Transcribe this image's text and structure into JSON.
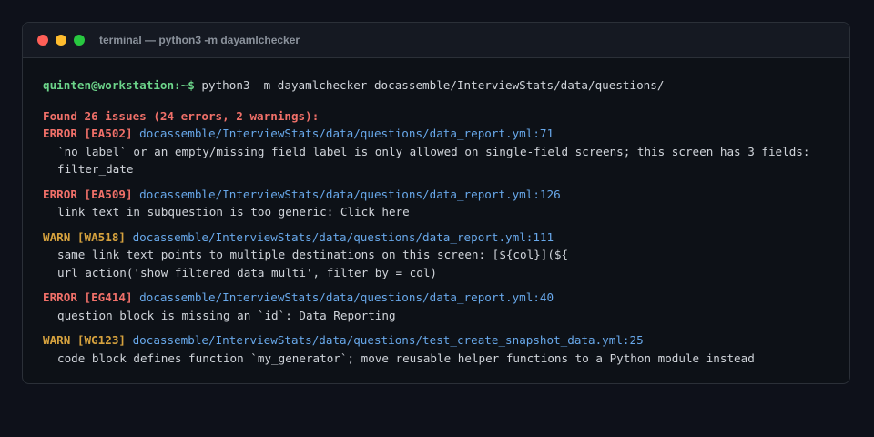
{
  "window": {
    "title": "terminal — python3 -m dayamlchecker",
    "dots": [
      "#ff5f57",
      "#febc2e",
      "#28c840"
    ]
  },
  "terminal": {
    "prompt": "quinten@workstation:~$",
    "command": "python3 -m dayamlchecker docassemble/InterviewStats/data/questions/",
    "summary": "Found 26 issues (24 errors, 2 warnings):",
    "issues": [
      {
        "level": "ERROR [EA502]",
        "path": "docassemble/InterviewStats/data/questions/data_report.yml:71",
        "message": "`no label` or an empty/missing field label is only allowed on single-field screens; this screen has 3 fields: filter_date"
      },
      {
        "level": "ERROR [EA509]",
        "path": "docassemble/InterviewStats/data/questions/data_report.yml:126",
        "message": "link text in subquestion is too generic: Click here"
      },
      {
        "level": "WARN [WA518]",
        "path": "docassemble/InterviewStats/data/questions/data_report.yml:111",
        "message": "same link text points to multiple destinations on this screen: [${col}](${ url_action('show_filtered_data_multi', filter_by = col)"
      },
      {
        "level": "ERROR [EG414]",
        "path": "docassemble/InterviewStats/data/questions/data_report.yml:40",
        "message": "question block is missing an `id`: Data Reporting"
      },
      {
        "level": "WARN [WG123]",
        "path": "docassemble/InterviewStats/data/questions/test_create_snapshot_data.yml:25",
        "message": "code block defines function `my_generator`; move reusable helper functions to a Python module instead"
      }
    ]
  }
}
